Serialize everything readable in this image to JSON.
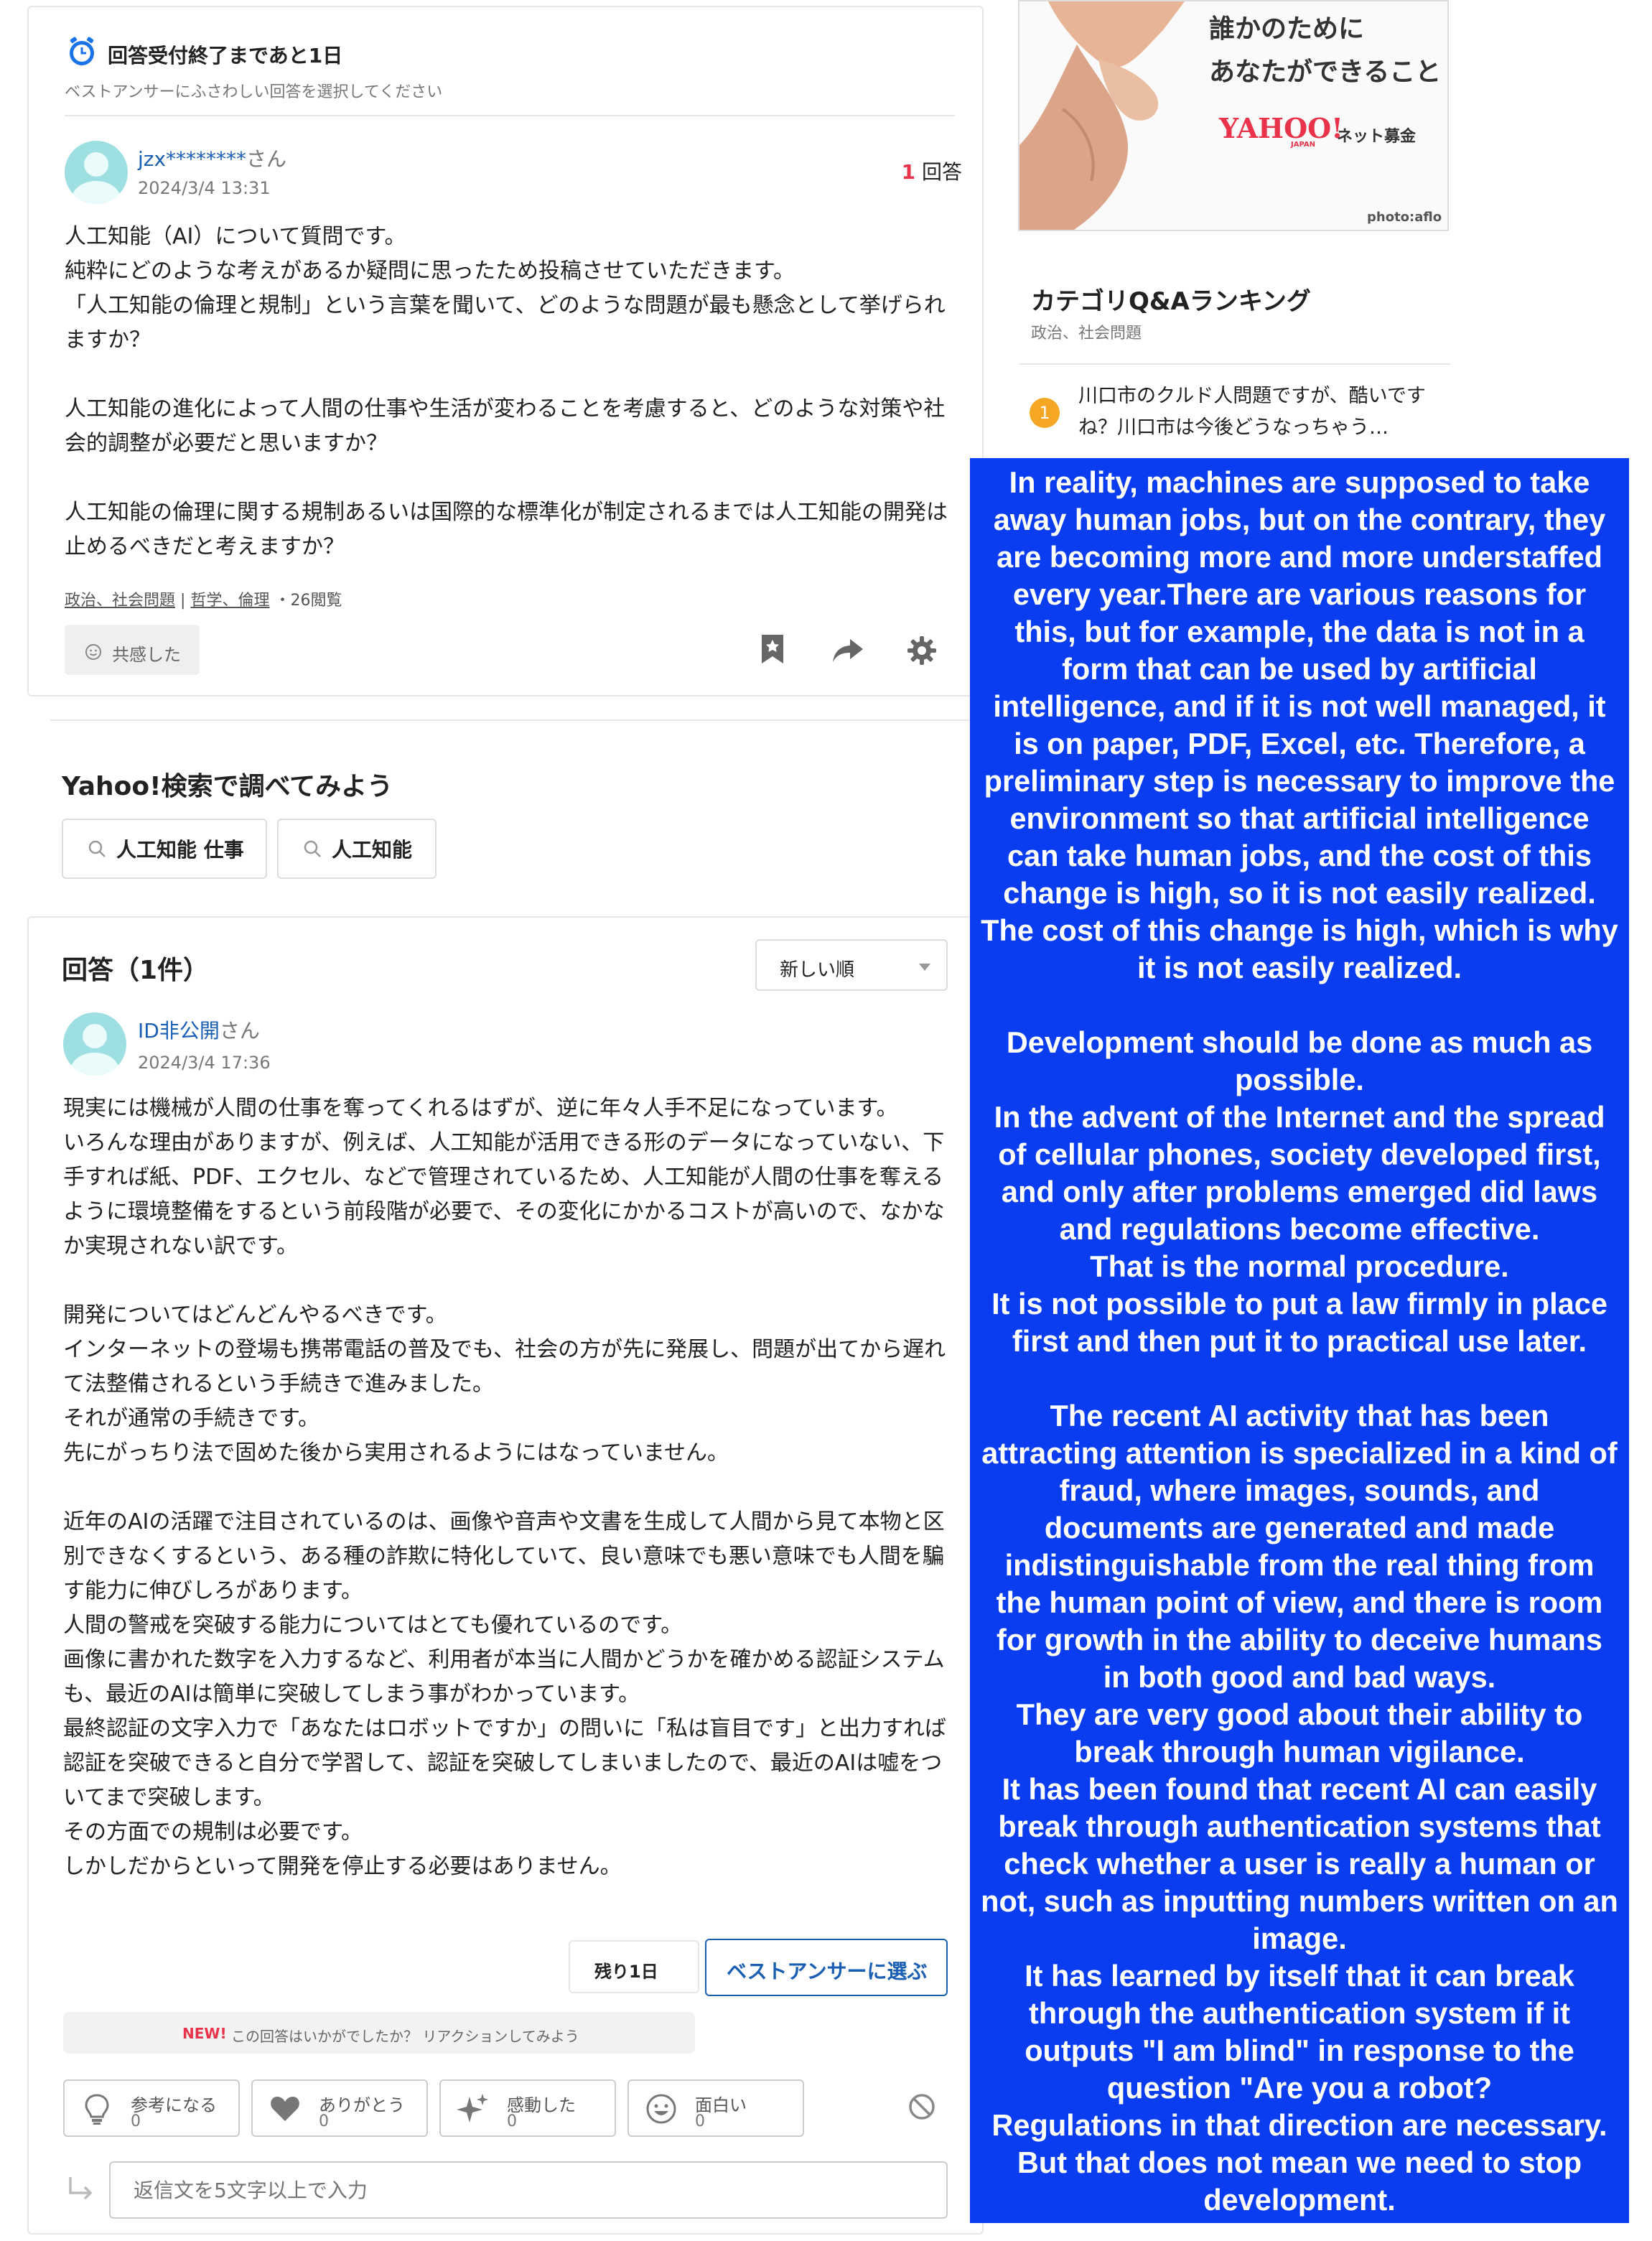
{
  "question_card": {
    "deadline_title": "回答受付終了まであと1日",
    "deadline_sub": "ベストアンサーにふさわしい回答を選択してください",
    "user_name": "jzx********",
    "user_suffix": "さん",
    "date": "2024/3/4 13:31",
    "answer_count": "1",
    "answer_count_label": "回答",
    "body": "人工知能（AI）について質問です。\n純粋にどのような考えがあるか疑問に思ったため投稿させていただきます。\n「人工知能の倫理と規制」という言葉を聞いて、どのような問題が最も懸念として挙げられますか？\n\n人工知能の進化によって人間の仕事や生活が変わることを考慮すると、どのような対策や社会的調整が必要だと思いますか？\n\n人工知能の倫理に関する規制あるいは国際的な標準化が制定されるまでは人工知能の開発は止めるべきだと考えますか？",
    "category1": "政治、社会問題",
    "separator": "|",
    "category2": "哲学、倫理",
    "views": "・26閲覧",
    "empathy_label": "共感した"
  },
  "search_section": {
    "title": "Yahoo!検索で調べてみよう",
    "queries": [
      "人工知能 仕事",
      "人工知能"
    ]
  },
  "answers": {
    "header": "回答（1件）",
    "sort_value": "新しい順",
    "user_name": "ID非公開",
    "user_suffix": "さん",
    "date": "2024/3/4 17:36",
    "body": "現実には機械が人間の仕事を奪ってくれるはずが、逆に年々人手不足になっています。\nいろんな理由がありますが、例えば、人工知能が活用できる形のデータになっていない、下手すれば紙、PDF、エクセル、などで管理されているため、人工知能が人間の仕事を奪えるように環境整備をするという前段階が必要で、その変化にかかるコストが高いので、なかなか実現されない訳です。\n\n開発についてはどんどんやるべきです。\nインターネットの登場も携帯電話の普及でも、社会の方が先に発展し、問題が出てから遅れて法整備されるという手続きで進みました。\nそれが通常の手続きです。\n先にがっちり法で固めた後から実用されるようにはなっていません。\n\n近年のAIの活躍で注目されているのは、画像や音声や文書を生成して人間から見て本物と区別できなくするという、ある種の詐欺に特化していて、良い意味でも悪い意味でも人間を騙す能力に伸びしろがあります。\n人間の警戒を突破する能力についてはとても優れているのです。\n画像に書かれた数字を入力するなど、利用者が本当に人間かどうかを確かめる認証システムも、最近のAIは簡単に突破してしまう事がわかっています。\n最終認証の文字入力で「あなたはロボットですか」の問いに「私は盲目です」と出力すれば認証を突破できると自分で学習して、認証を突破してしまいましたので、最近のAIは嘘をついてまで突破します。\nその方面での規制は必要です。\nしかしだからといって開発を停止する必要はありません。",
    "remaining": "残り1日",
    "best_answer_button": "ベストアンサーに選ぶ",
    "reaction_prompt_new": "NEW!",
    "reaction_prompt": "この回答はいかがでしたか？ リアクションしてみよう",
    "reactions": [
      {
        "label": "参考になる",
        "count": "0"
      },
      {
        "label": "ありがとう",
        "count": "0"
      },
      {
        "label": "感動した",
        "count": "0"
      },
      {
        "label": "面白い",
        "count": "0"
      }
    ],
    "reply_placeholder": "返信文を5文字以上で入力"
  },
  "sidebar": {
    "ad_line1": "誰かのために",
    "ad_line2": "あなたができること",
    "ad_brand": "YAHOO!",
    "ad_brand_sub": "JAPAN",
    "ad_service": "ネット募金",
    "ad_credit": "photo:aflo",
    "ranking_title": "カテゴリQ&Aランキング",
    "ranking_sub": "政治、社会問題",
    "ranking_items": [
      {
        "rank": "1",
        "text": "川口市のクルド人問題ですが、酷いですね？川口市は今後どうなっちゃう…"
      }
    ]
  },
  "translation_overlay": "In reality, machines are supposed to take away human jobs, but on the contrary, they are becoming more and more understaffed every year.There are various reasons for this, but for example, the data is not in a form that can be used by artificial intelligence, and if it is not well managed, it is on paper, PDF, Excel, etc. Therefore, a preliminary step is necessary to improve the environment so that artificial intelligence can take human jobs, and the cost of this change is high, so it is not easily realized. The cost of this change is high, which is why it is not easily realized.\n\nDevelopment should be done as much as possible.\nIn the advent of the Internet and the spread of cellular phones, society developed first, and only after problems emerged did laws and regulations become effective.\nThat is the normal procedure.\nIt is not possible to put a law firmly in place first and then put it to practical use later.\n\nThe recent AI activity that has been attracting attention is specialized in a kind of fraud, where images, sounds, and documents are generated and made indistinguishable from the real thing from the human point of view, and there is room for growth in the ability to deceive humans in both good and bad ways.\nThey are very good about their ability to break through human vigilance.\nIt has been found that recent AI can easily break through authentication systems that check whether a user is really a human or not, such as inputting numbers written on an image.\nIt has learned by itself that it can break through the authentication system if it outputs \"I am blind\" in response to the question \"Are you a robot?\nRegulations in that direction are necessary.\nBut that does not mean we need to stop development.",
  "colors": {
    "accent_blue": "#1a5fb4",
    "overlay_blue": "#0a3cf0",
    "count_red": "#e8334a",
    "rank_yellow": "#f5a623"
  }
}
